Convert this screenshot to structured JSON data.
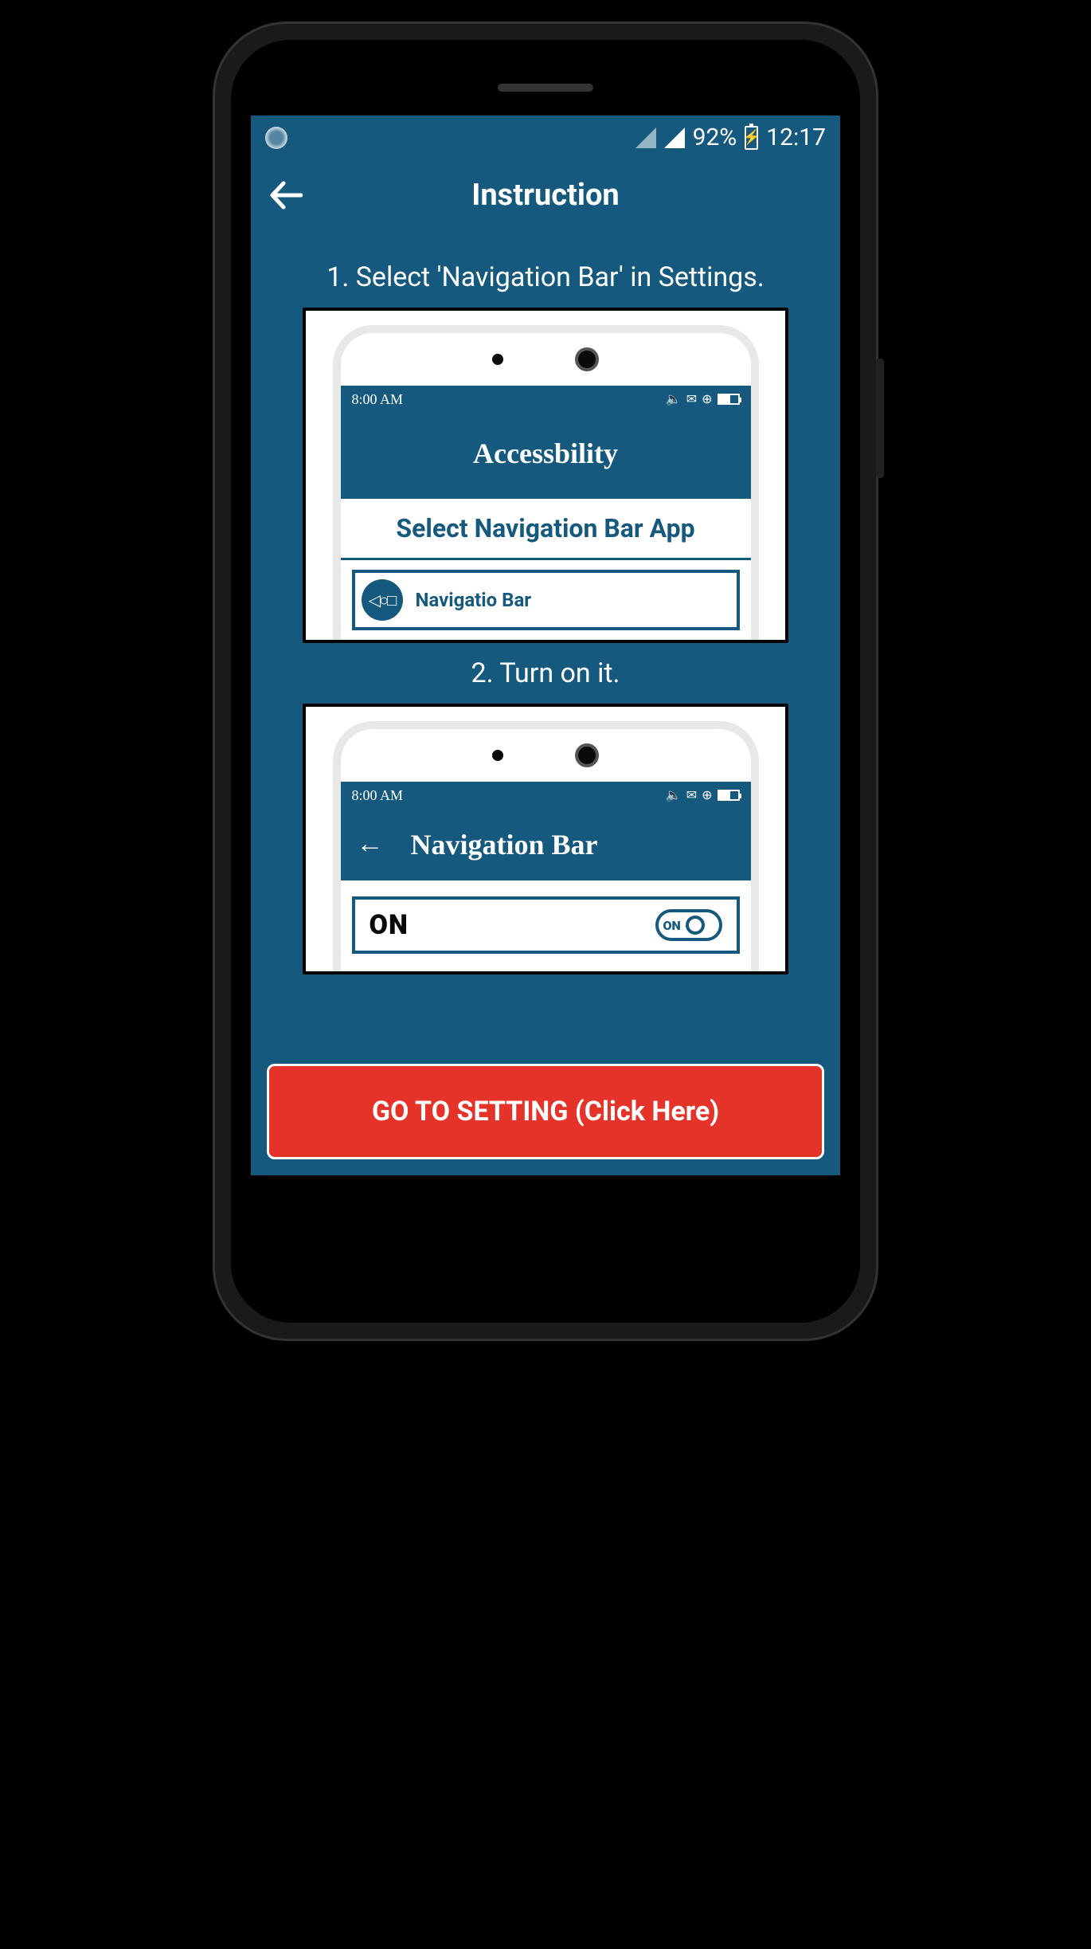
{
  "statusBar": {
    "battery": "92%",
    "time": "12:17"
  },
  "appBar": {
    "title": "Instruction"
  },
  "steps": {
    "step1": "1. Select 'Navigation Bar' in Settings.",
    "step2": "2. Turn on it."
  },
  "illus1": {
    "time": "8:00 AM",
    "header": "Accessbility",
    "sub": "Select Navigation Bar App",
    "item": "Navigatio Bar"
  },
  "illus2": {
    "time": "8:00 AM",
    "header": "Navigation Bar",
    "onLabel": "ON",
    "toggleLabel": "ON"
  },
  "cta": "GO TO SETTING (Click Here)"
}
